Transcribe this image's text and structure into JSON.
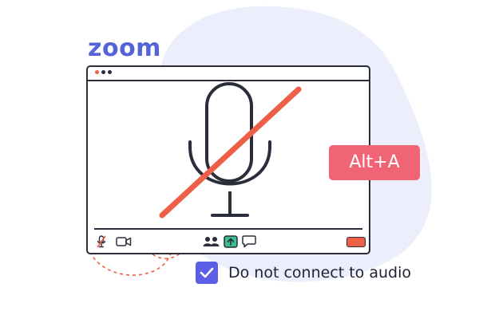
{
  "brand": {
    "logo_text": "zoom",
    "color": "#5563d8"
  },
  "window": {
    "titlebar_dots": [
      "#ee5f47",
      "#2a2d3a",
      "#2a2d3a"
    ],
    "main_graphic": "crossed-out-microphone-icon",
    "toolbar": {
      "left_icons": [
        "muted-microphone-icon",
        "video-camera-icon"
      ],
      "center_icons": [
        "participants-icon",
        "share-screen-icon",
        "chat-icon"
      ],
      "end_button_color": "#ee5f47"
    }
  },
  "shortcut": {
    "label": "Alt+A",
    "color": "#f06475"
  },
  "audio_option": {
    "label": "Do not connect to audio",
    "checked": true,
    "checkbox_color": "#5b5ee6"
  },
  "colors": {
    "outline": "#2a2d3a",
    "accent_red": "#ee5f47",
    "background_blob": "#eceefb"
  }
}
